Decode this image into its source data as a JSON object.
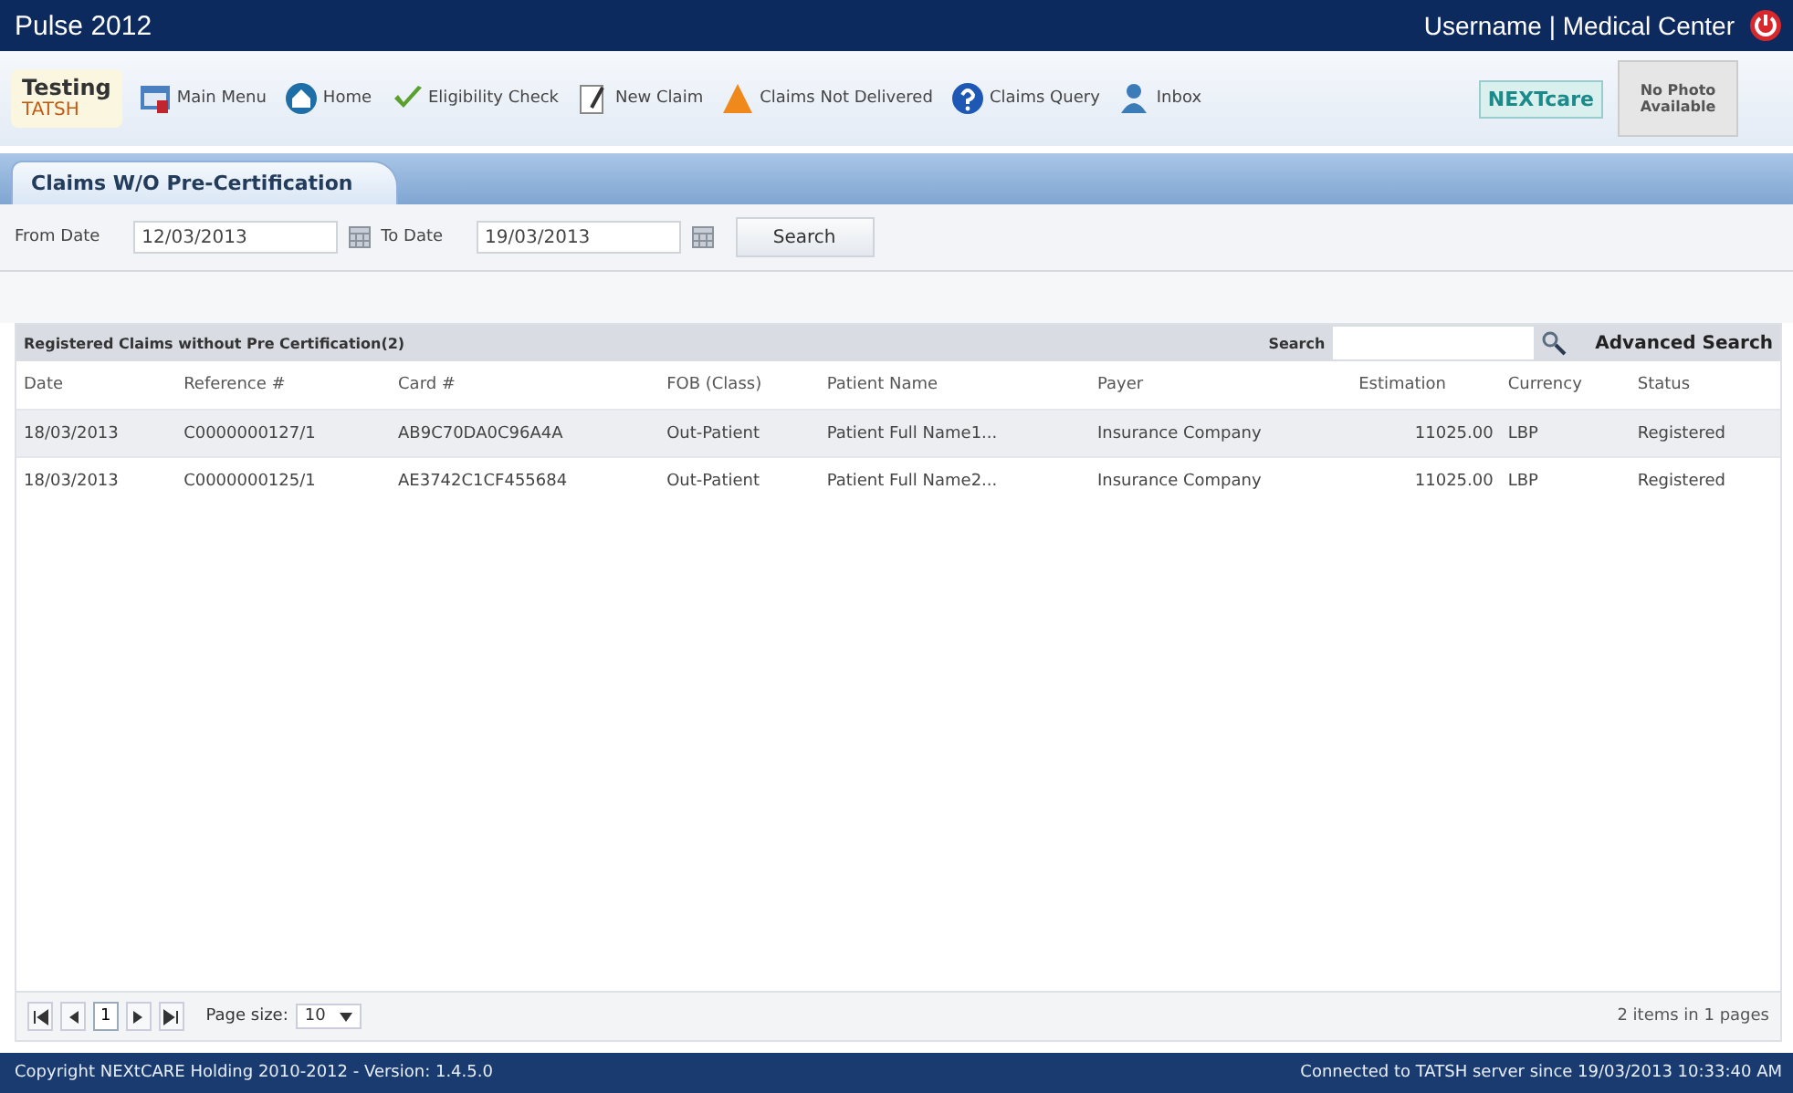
{
  "window": {
    "title": "Pulse 2012",
    "user": "Username | Medical Center"
  },
  "logo": {
    "line1": "Testing",
    "line2": "TATSH"
  },
  "toolbar": [
    {
      "label": "Main Menu",
      "kind": "menu"
    },
    {
      "label": "Home",
      "kind": "home"
    },
    {
      "label": "Eligibility Check",
      "kind": "check"
    },
    {
      "label": "New Claim",
      "kind": "claim"
    },
    {
      "label": "Claims Not Delivered",
      "kind": "warning"
    },
    {
      "label": "Claims Query",
      "kind": "help"
    },
    {
      "label": "Inbox",
      "kind": "inbox"
    }
  ],
  "brand": "NEXTcare",
  "photo": "No Photo Available",
  "tabs": [
    {
      "label": "Claims W/O Pre-Certification",
      "selected": true
    }
  ],
  "filter": {
    "from_label": "From Date",
    "from_value": "12/03/2013",
    "to_label": "To Date",
    "to_value": "19/03/2013",
    "button": "Search"
  },
  "grid": {
    "title": "Registered Claims without Pre Certification(2)",
    "search_label": "Search",
    "advanced": "Advanced Search",
    "columns": [
      "Date",
      "Reference #",
      "Card #",
      "FOB (Class)",
      "Patient Name",
      "Payer",
      "Estimation",
      "Currency",
      "Status"
    ],
    "rows": [
      [
        "18/03/2013",
        "C0000000127/1",
        "AB9C70DA0C96A4A",
        "Out-Patient",
        "Patient Full Name1...",
        "Insurance Company",
        "11025.00",
        "LBP",
        "Registered"
      ],
      [
        "18/03/2013",
        "C0000000125/1",
        "AE3742C1CF455684",
        "Out-Patient",
        "Patient Full Name2...",
        "Insurance Company",
        "11025.00",
        "LBP",
        "Registered"
      ]
    ]
  },
  "pager": {
    "page": "1",
    "size_label": "Page size:",
    "size": "10",
    "summary": "2 items in 1 pages"
  },
  "status_bar": {
    "copyright": "Copyright NEXtCARE Holding 2010-2012 - Version: 1.4.5.0",
    "connection": "Connected to TATSH server since 19/03/2013 10:33:40 AM"
  }
}
